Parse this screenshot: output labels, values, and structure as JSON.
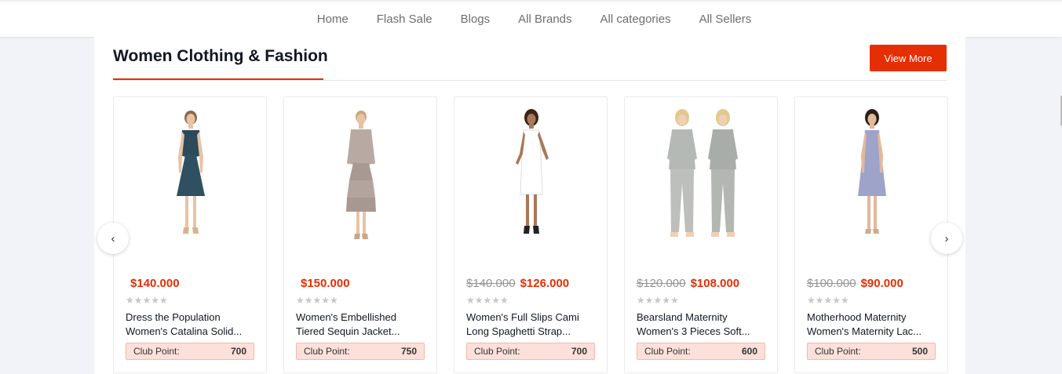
{
  "nav": {
    "items": [
      "Home",
      "Flash Sale",
      "Blogs",
      "All Brands",
      "All categories",
      "All Sellers"
    ]
  },
  "section": {
    "title": "Women Clothing & Fashion",
    "view_more": "View More"
  },
  "arrows": {
    "left": "‹",
    "right": "›"
  },
  "stars_text": "★★★★★",
  "products": [
    {
      "old_price": "",
      "price": "$140.000",
      "name_line1": "Dress the Population",
      "name_line2": "Women's Catalina Solid...",
      "club_label": "Club Point:",
      "club_points": "700"
    },
    {
      "old_price": "",
      "price": "$150.000",
      "name_line1": "Women's Embellished",
      "name_line2": "Tiered Sequin Jacket...",
      "club_label": "Club Point:",
      "club_points": "750"
    },
    {
      "old_price": "$140.000",
      "price": "$126.000",
      "name_line1": "Women's Full Slips Cami",
      "name_line2": "Long Spaghetti Strap...",
      "club_label": "Club Point:",
      "club_points": "700"
    },
    {
      "old_price": "$120.000",
      "price": "$108.000",
      "name_line1": "Bearsland Maternity",
      "name_line2": "Women's 3 Pieces Soft...",
      "club_label": "Club Point:",
      "club_points": "600"
    },
    {
      "old_price": "$100.000",
      "price": "$90.000",
      "name_line1": "Motherhood Maternity",
      "name_line2": "Women's Maternity Lac...",
      "club_label": "Club Point:",
      "club_points": "500"
    }
  ],
  "colors": {
    "accent": "#e62e04",
    "club_bg": "#fde0da"
  }
}
